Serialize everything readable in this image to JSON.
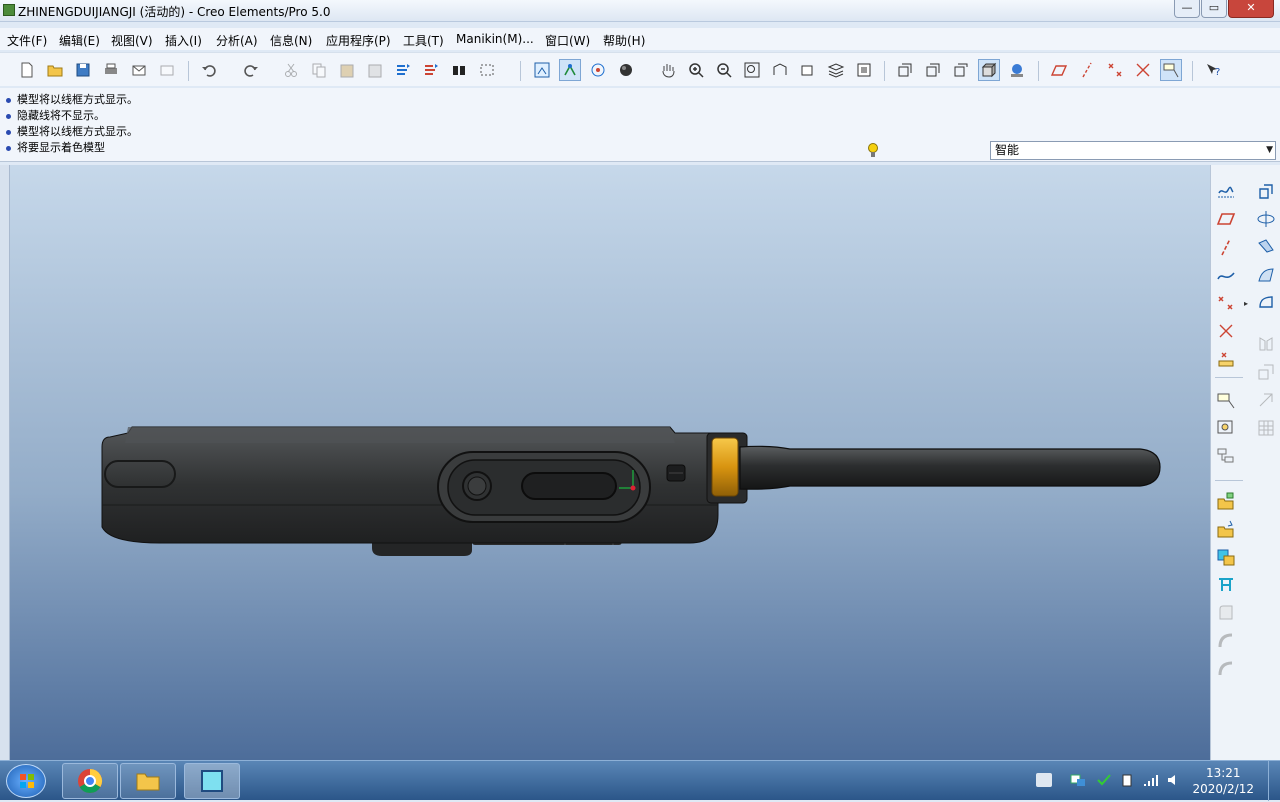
{
  "window": {
    "title": "ZHINENGDUIJIANGJI (活动的) - Creo Elements/Pro 5.0"
  },
  "menubar": {
    "items": [
      {
        "label": "文件(F)"
      },
      {
        "label": "编辑(E)"
      },
      {
        "label": "视图(V)"
      },
      {
        "label": "插入(I)"
      },
      {
        "label": "分析(A)"
      },
      {
        "label": "信息(N)"
      },
      {
        "label": "应用程序(P)"
      },
      {
        "label": "工具(T)"
      },
      {
        "label": "Manikin(M)..."
      },
      {
        "label": "窗口(W)"
      },
      {
        "label": "帮助(H)"
      }
    ]
  },
  "messages": [
    {
      "text": "模型将以线框方式显示。"
    },
    {
      "text": "隐藏线将不显示。"
    },
    {
      "text": "模型将以线框方式显示。"
    },
    {
      "text": "将要显示着色模型"
    }
  ],
  "filter": {
    "value": "智能"
  },
  "taskbar": {
    "time": "13:21",
    "date": "2020/2/12"
  },
  "colors": {
    "antenna_ring": "#e2a21a",
    "body": "#2f3132",
    "viewport_top": "#c6d8ea",
    "viewport_bottom": "#4d6d9a"
  }
}
